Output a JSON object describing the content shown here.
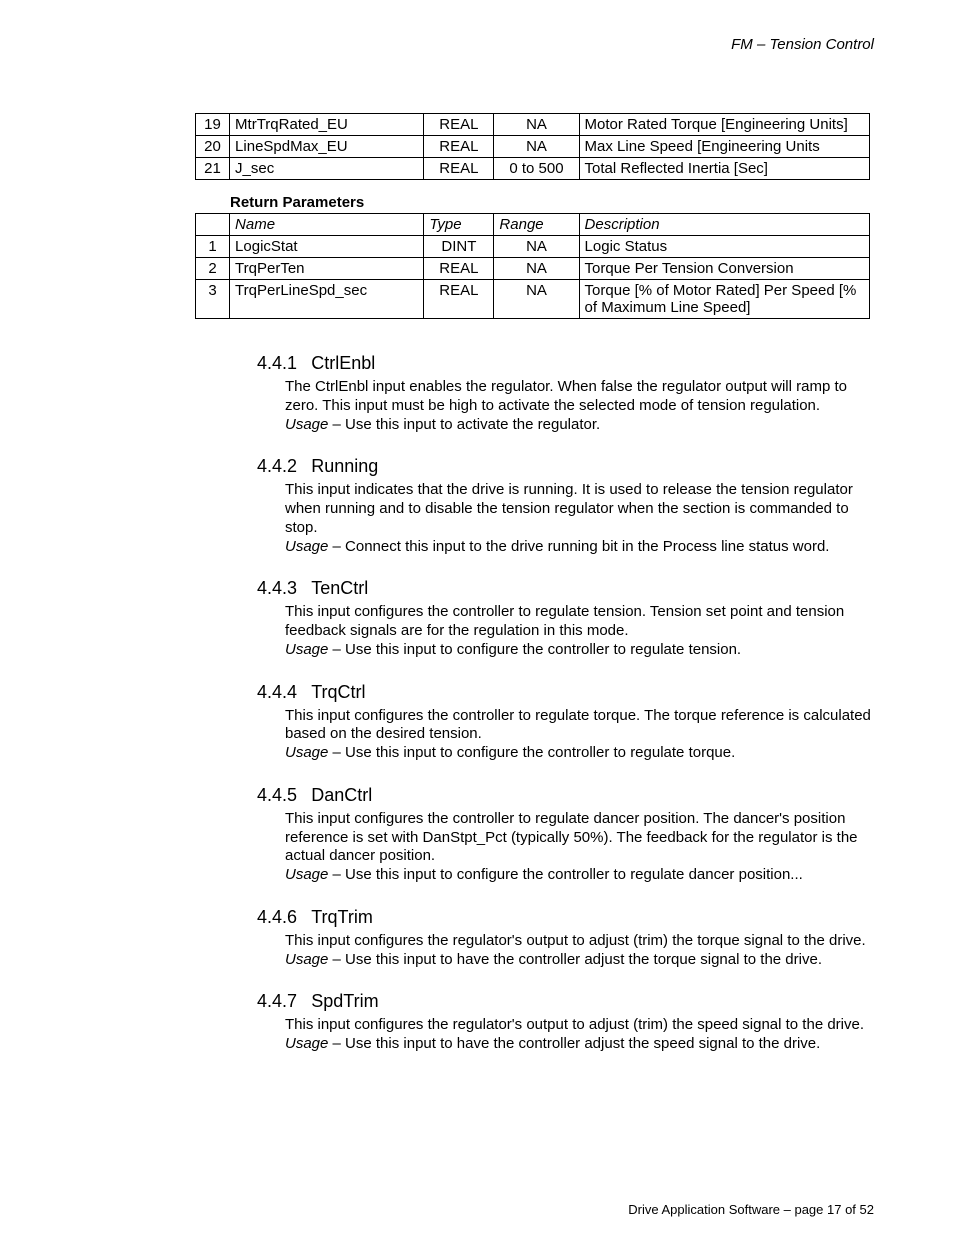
{
  "header": {
    "title": "FM – Tension Control"
  },
  "table1": {
    "rows": [
      {
        "num": "19",
        "name": "MtrTrqRated_EU",
        "type": "REAL",
        "range": "NA",
        "desc": "Motor Rated Torque [Engineering Units]"
      },
      {
        "num": "20",
        "name": "LineSpdMax_EU",
        "type": "REAL",
        "range": "NA",
        "desc": "Max Line Speed [Engineering Units"
      },
      {
        "num": "21",
        "name": "J_sec",
        "type": "REAL",
        "range": "0 to 500",
        "desc": "Total Reflected Inertia [Sec]"
      }
    ]
  },
  "return_params": {
    "label": "Return Parameters",
    "header": {
      "name": "Name",
      "type": "Type",
      "range": "Range",
      "desc": "Description"
    },
    "rows": [
      {
        "num": "1",
        "name": "LogicStat",
        "type": "DINT",
        "range": "NA",
        "desc": "Logic Status"
      },
      {
        "num": "2",
        "name": "TrqPerTen",
        "type": "REAL",
        "range": "NA",
        "desc": "Torque Per Tension Conversion"
      },
      {
        "num": "3",
        "name": "TrqPerLineSpd_sec",
        "type": "REAL",
        "range": "NA",
        "desc": "Torque [% of Motor Rated] Per Speed [% of Maximum Line Speed]"
      }
    ]
  },
  "sections": [
    {
      "num": "4.4.1",
      "title": "CtrlEnbl",
      "body": "The CtrlEnbl input enables the regulator.  When false the regulator output will ramp to zero.  This input must be high to activate the selected mode of tension regulation.",
      "usage_label": "Usage",
      "usage": " – Use this input to activate the regulator."
    },
    {
      "num": "4.4.2",
      "title": "Running",
      "body": "This input indicates that the drive is running.  It is used to release the tension regulator when running and to disable the tension regulator when the section is commanded to stop.",
      "usage_label": "Usage",
      "usage": " – Connect this input to the drive running bit in the Process line status word."
    },
    {
      "num": "4.4.3",
      "title": "TenCtrl",
      "body": "This input configures the controller to regulate tension.  Tension set point and tension feedback signals are for the regulation in this mode.",
      "usage_label": "Usage",
      "usage": " – Use this input to configure the controller to regulate tension."
    },
    {
      "num": "4.4.4",
      "title": "TrqCtrl",
      "body": "This input configures the controller to regulate torque.  The torque reference is calculated based on the desired tension.",
      "usage_label": "Usage",
      "usage": " – Use this input to configure the controller to regulate torque."
    },
    {
      "num": "4.4.5",
      "title": "DanCtrl",
      "body": "This input configures the controller to regulate dancer position.  The dancer's position reference is set with DanStpt_Pct (typically 50%).  The feedback for the regulator is the actual dancer position.",
      "usage_label": "Usage",
      "usage": " – Use this input to configure the controller to regulate dancer position..."
    },
    {
      "num": "4.4.6",
      "title": "TrqTrim",
      "body": "This input configures the regulator's output to adjust (trim) the torque signal to the drive.",
      "usage_label": "Usage",
      "usage": " – Use this input to have the controller adjust the torque signal to the drive."
    },
    {
      "num": "4.4.7",
      "title": "SpdTrim",
      "body": "This input configures the regulator's output to adjust (trim) the speed signal to the drive.",
      "usage_label": "Usage",
      "usage": " – Use this input to have the controller adjust the speed signal to the drive."
    }
  ],
  "footer": "Drive Application Software – page 17 of 52"
}
